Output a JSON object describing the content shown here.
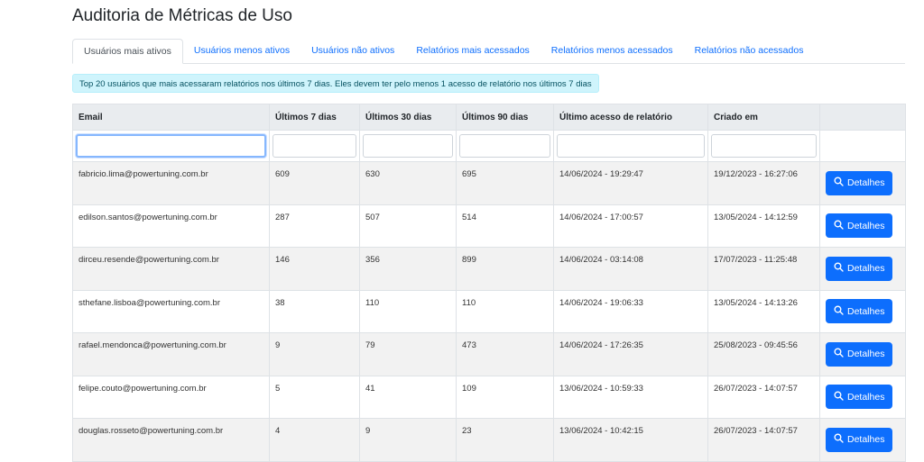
{
  "page": {
    "title": "Auditoria de Métricas de Uso"
  },
  "tabs": [
    {
      "label": "Usuários mais ativos",
      "active": true
    },
    {
      "label": "Usuários menos ativos",
      "active": false
    },
    {
      "label": "Usuários não ativos",
      "active": false
    },
    {
      "label": "Relatórios mais acessados",
      "active": false
    },
    {
      "label": "Relatórios menos acessados",
      "active": false
    },
    {
      "label": "Relatórios não acessados",
      "active": false
    }
  ],
  "alert": {
    "text": "Top 20 usuários que mais acessaram relatórios nos últimos 7 dias. Eles devem ter pelo menos 1 acesso de relatório nos últimos 7 dias"
  },
  "table": {
    "headers": [
      "Email",
      "Últimos 7 dias",
      "Últimos 30 dias",
      "Últimos 90 dias",
      "Último acesso de relatório",
      "Criado em",
      ""
    ],
    "detail_label": "Detalhes",
    "rows": [
      [
        "fabricio.lima@powertuning.com.br",
        "609",
        "630",
        "695",
        "14/06/2024 - 19:29:47",
        "19/12/2023 - 16:27:06"
      ],
      [
        "edilson.santos@powertuning.com.br",
        "287",
        "507",
        "514",
        "14/06/2024 - 17:00:57",
        "13/05/2024 - 14:12:59"
      ],
      [
        "dirceu.resende@powertuning.com.br",
        "146",
        "356",
        "899",
        "14/06/2024 - 03:14:08",
        "17/07/2023 - 11:25:48"
      ],
      [
        "sthefane.lisboa@powertuning.com.br",
        "38",
        "110",
        "110",
        "14/06/2024 - 19:06:33",
        "13/05/2024 - 14:13:26"
      ],
      [
        "rafael.mendonca@powertuning.com.br",
        "9",
        "79",
        "473",
        "14/06/2024 - 17:26:35",
        "25/08/2023 - 09:45:56"
      ],
      [
        "felipe.couto@powertuning.com.br",
        "5",
        "41",
        "109",
        "13/06/2024 - 10:59:33",
        "26/07/2023 - 14:07:57"
      ],
      [
        "douglas.rosseto@powertuning.com.br",
        "4",
        "9",
        "23",
        "13/06/2024 - 10:42:15",
        "26/07/2023 - 14:07:57"
      ]
    ]
  },
  "colors": {
    "primary": "#0d6efd",
    "alert_bg": "#cff4fc",
    "header_bg": "#e9ecef",
    "stripe": "#f2f2f2"
  },
  "icons": {
    "detail_button": "search-icon"
  }
}
